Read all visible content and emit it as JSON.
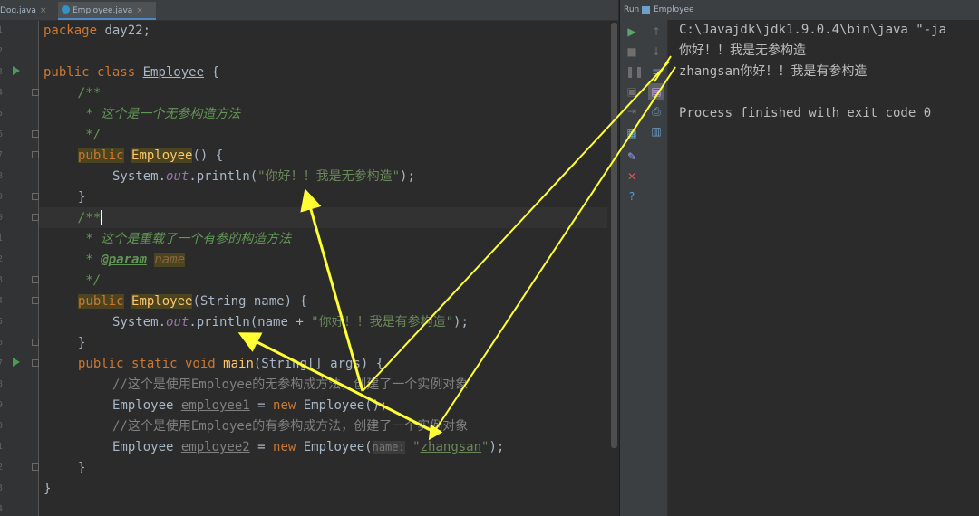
{
  "tabs": [
    {
      "label": "Dog.java",
      "close": "×"
    },
    {
      "label": "Employee.java",
      "close": "×"
    }
  ],
  "run_panel": {
    "title": "Run",
    "config": "Employee"
  },
  "console": [
    "C:\\Javajdk\\jdk1.9.0.4\\bin\\java \"-ja",
    "你好！！我是无参构造",
    "zhangsan你好！！我是有参构造",
    "",
    "Process finished with exit code 0"
  ],
  "code": {
    "l1": {
      "kw": "package",
      "rest": " day22;"
    },
    "l3": {
      "kw": "public class",
      "name": "Employee",
      "rest": " {"
    },
    "l4": "/**",
    "l5": " * 这个是一个无参构造方法",
    "l6": " */",
    "l7": {
      "kw": "public",
      "name": "Employee",
      "rest": "() {"
    },
    "l8": {
      "a": "System.",
      "fld": "out",
      "b": ".println(",
      "str": "\"你好！！我是无参构造\"",
      "c": ");"
    },
    "l9": "}",
    "l10": "/**",
    "l11": " * 这个是重载了一个有参的构造方法",
    "l12": {
      "pre": " * ",
      "tag": "@param",
      "param": "name"
    },
    "l13": " */",
    "l14": {
      "kw": "public",
      "name": "Employee",
      "rest": "(String name) {"
    },
    "l15": {
      "a": "System.",
      "fld": "out",
      "b": ".println(name + ",
      "str": "\"你好！！我是有参构造\"",
      "c": ");"
    },
    "l16": "}",
    "l17": {
      "kw": "public static void",
      "name": "main",
      "rest": "(String[] args) {"
    },
    "l18": "//这个是使用Employee的无参构成方法，创建了一个实例对象",
    "l19": {
      "a": "Employee ",
      "var": "employee1",
      "b": " = ",
      "kw": "new",
      "c": " Employee();"
    },
    "l20": "//这个是使用Employee的有参构成方法，创建了一个实例对象",
    "l21": {
      "a": "Employee ",
      "var": "employee2",
      "b": " = ",
      "kw": "new",
      "c": " Employee(",
      "hint": "name:",
      "q1": "\"",
      "str": "zhangsan",
      "q2": "\"",
      "d": ");"
    },
    "l22": "}",
    "l23": "}"
  },
  "line_numbers": [
    "1",
    "2",
    "3",
    "4",
    "5",
    "6",
    "7",
    "8",
    "9",
    "0",
    "1",
    "2",
    "3",
    "4",
    "5",
    "6",
    "7",
    "8",
    "9",
    "0",
    "1",
    "2",
    "3",
    "4"
  ],
  "toolbar_icons": [
    "run-icon",
    "stop-icon",
    "pause-icon",
    "step-icon",
    "scroll-icon",
    "print-icon",
    "pin-icon",
    "close-icon",
    "help-icon",
    "up-icon",
    "down-icon",
    "wrap-icon",
    "soft-wrap-icon",
    "print-output-icon",
    "trash-icon"
  ],
  "colors": {
    "background": "#2b2b2b",
    "keyword": "#cc7832",
    "string": "#6a8759",
    "comment": "#629755",
    "arrow": "#ffff33"
  }
}
